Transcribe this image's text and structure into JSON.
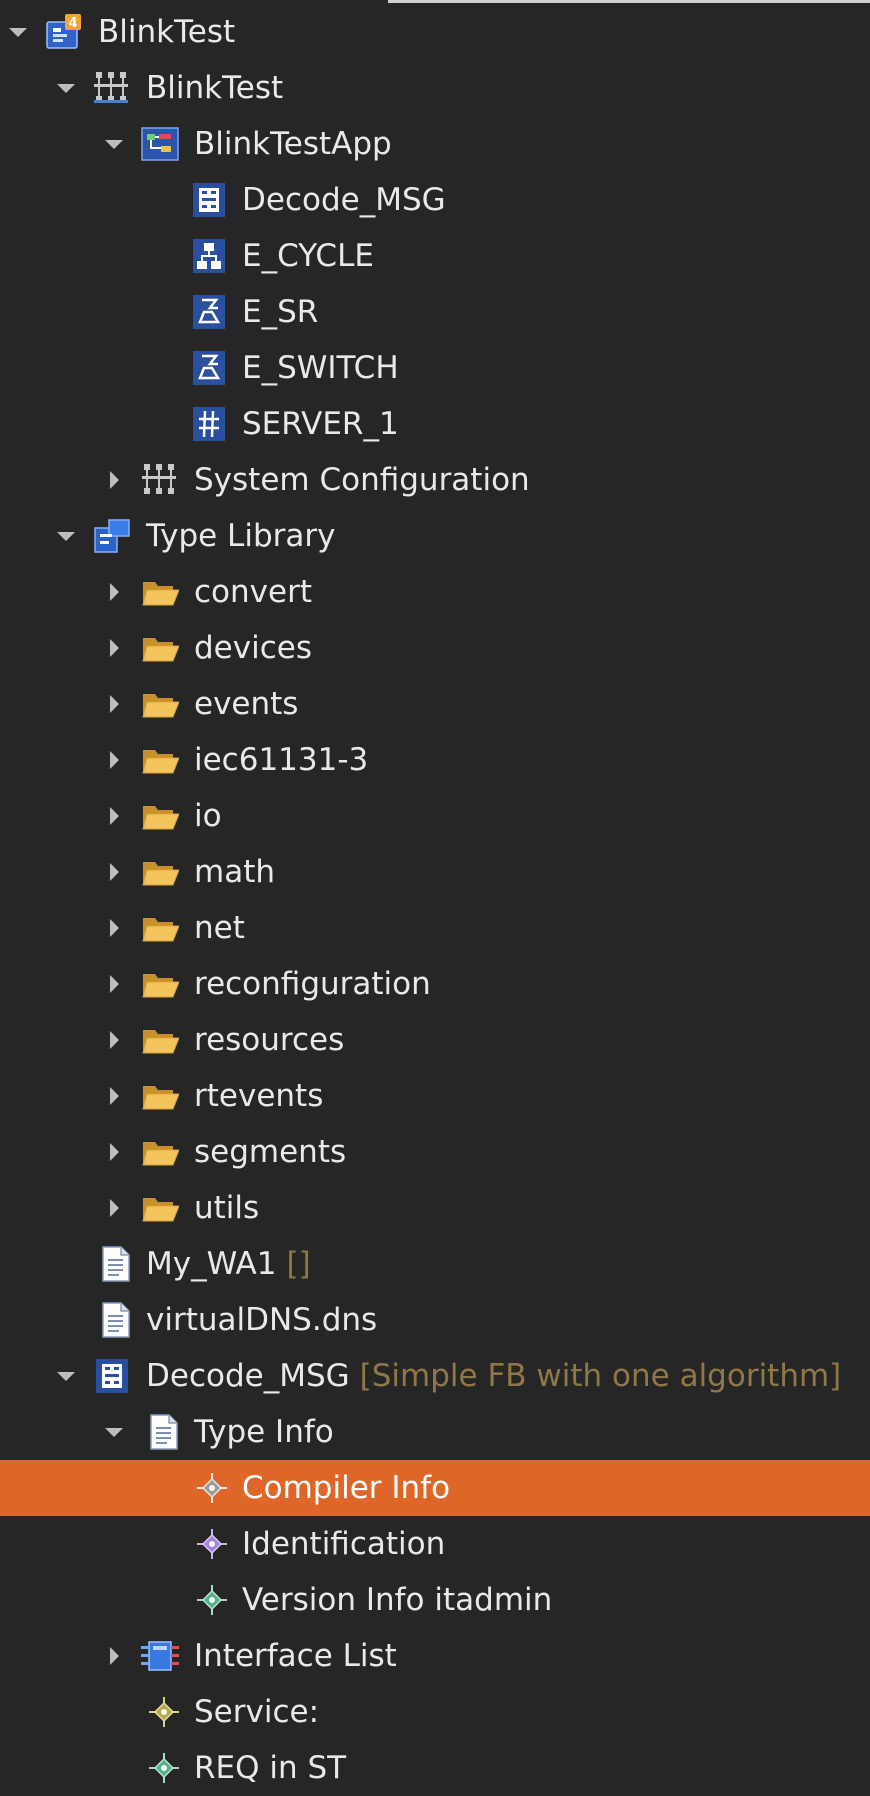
{
  "tree": {
    "items": [
      {
        "label": "BlinkTest",
        "note": "",
        "icon": "project-icon",
        "toggle": "expanded"
      },
      {
        "label": "BlinkTest",
        "note": "",
        "icon": "system-icon",
        "toggle": "expanded"
      },
      {
        "label": "BlinkTestApp",
        "note": "",
        "icon": "application-icon",
        "toggle": "expanded"
      },
      {
        "label": "Decode_MSG",
        "note": "",
        "icon": "basic-fb-icon",
        "toggle": "none"
      },
      {
        "label": "E_CYCLE",
        "note": "",
        "icon": "composite-fb-icon",
        "toggle": "none"
      },
      {
        "label": "E_SR",
        "note": "",
        "icon": "service-fb-icon",
        "toggle": "none"
      },
      {
        "label": "E_SWITCH",
        "note": "",
        "icon": "service-fb-icon",
        "toggle": "none"
      },
      {
        "label": "SERVER_1",
        "note": "",
        "icon": "interface-fb-icon",
        "toggle": "none"
      },
      {
        "label": "System Configuration",
        "note": "",
        "icon": "system-configuration-icon",
        "toggle": "collapsed"
      },
      {
        "label": "Type Library",
        "note": "",
        "icon": "type-library-icon",
        "toggle": "expanded"
      },
      {
        "label": "convert",
        "note": "",
        "icon": "folder-icon",
        "toggle": "collapsed"
      },
      {
        "label": "devices",
        "note": "",
        "icon": "folder-icon",
        "toggle": "collapsed"
      },
      {
        "label": "events",
        "note": "",
        "icon": "folder-icon",
        "toggle": "collapsed"
      },
      {
        "label": "iec61131-3",
        "note": "",
        "icon": "folder-icon",
        "toggle": "collapsed"
      },
      {
        "label": "io",
        "note": "",
        "icon": "folder-icon",
        "toggle": "collapsed"
      },
      {
        "label": "math",
        "note": "",
        "icon": "folder-icon",
        "toggle": "collapsed"
      },
      {
        "label": "net",
        "note": "",
        "icon": "folder-icon",
        "toggle": "collapsed"
      },
      {
        "label": "reconfiguration",
        "note": "",
        "icon": "folder-icon",
        "toggle": "collapsed"
      },
      {
        "label": "resources",
        "note": "",
        "icon": "folder-icon",
        "toggle": "collapsed"
      },
      {
        "label": "rtevents",
        "note": "",
        "icon": "folder-icon",
        "toggle": "collapsed"
      },
      {
        "label": "segments",
        "note": "",
        "icon": "folder-icon",
        "toggle": "collapsed"
      },
      {
        "label": "utils",
        "note": "",
        "icon": "folder-icon",
        "toggle": "collapsed"
      },
      {
        "label": "My_WA1",
        "note": "[]",
        "icon": "file-icon",
        "toggle": "none"
      },
      {
        "label": "virtualDNS.dns",
        "note": "",
        "icon": "file-icon",
        "toggle": "none"
      },
      {
        "label": "Decode_MSG",
        "note": "[Simple FB with one algorithm]",
        "icon": "basic-fb-icon",
        "toggle": "expanded"
      },
      {
        "label": "Type Info",
        "note": "",
        "icon": "type-info-icon",
        "toggle": "expanded"
      },
      {
        "label": "Compiler Info",
        "note": "",
        "icon": "compiler-info-icon",
        "toggle": "none"
      },
      {
        "label": "Identification",
        "note": "",
        "icon": "identification-icon",
        "toggle": "none"
      },
      {
        "label": "Version Info itadmin",
        "note": "",
        "icon": "version-info-icon",
        "toggle": "none"
      },
      {
        "label": "Interface List",
        "note": "",
        "icon": "interface-list-icon",
        "toggle": "collapsed"
      },
      {
        "label": "Service:",
        "note": "",
        "icon": "service-icon",
        "toggle": "none"
      },
      {
        "label": "REQ in ST",
        "note": "",
        "icon": "algorithm-icon",
        "toggle": "none"
      }
    ],
    "selected_label": "Compiler Info"
  },
  "colors": {
    "background": "#262626",
    "selection": "#de6628",
    "text": "#e9e9e9",
    "annotation": "#8f7748"
  }
}
